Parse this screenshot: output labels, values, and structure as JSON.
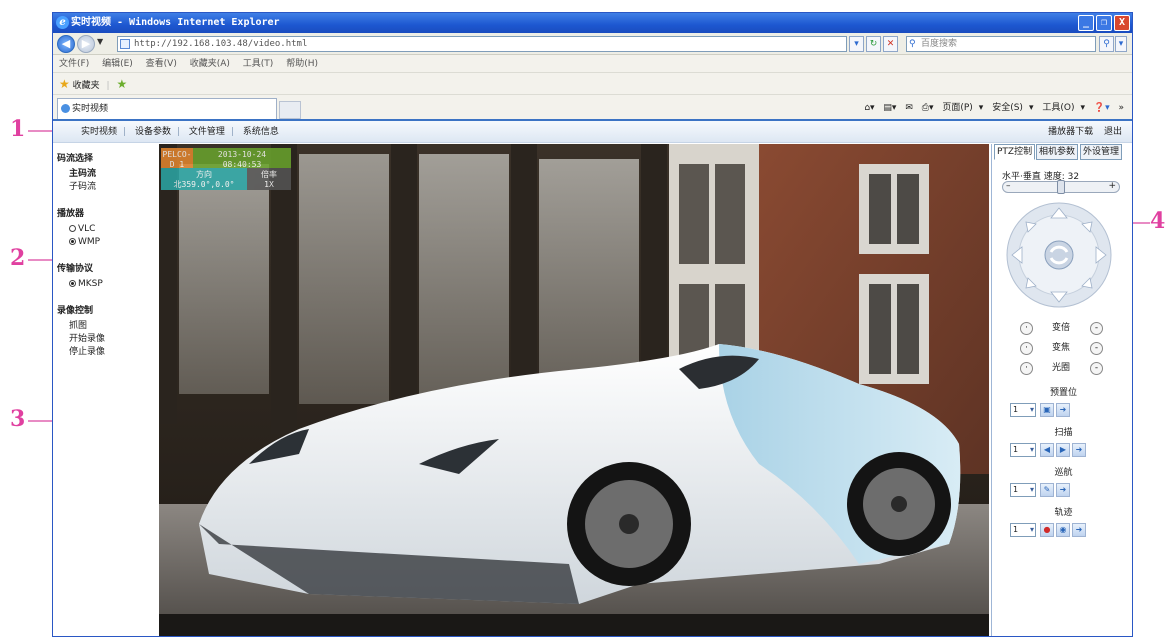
{
  "annotations": [
    "1",
    "2",
    "3",
    "4"
  ],
  "window": {
    "title": "实时视频 - Windows Internet Explorer",
    "minimize_glyph": "_",
    "maximize_glyph": "❐",
    "close_glyph": "X"
  },
  "address": {
    "url": "http://192.168.103.48/video.html",
    "search_placeholder": "百度搜索"
  },
  "menu": [
    "文件(F)",
    "编辑(E)",
    "查看(V)",
    "收藏夹(A)",
    "工具(T)",
    "帮助(H)"
  ],
  "favorites": {
    "label": "收藏夹"
  },
  "tab": {
    "title": "实时视频"
  },
  "command_bar": [
    "页面(P)",
    "安全(S)",
    "工具(O)"
  ],
  "nav": {
    "items": [
      "实时视频",
      "设备参数",
      "文件管理",
      "系统信息"
    ],
    "player_download": "播放器下载",
    "logout": "退出"
  },
  "sidebar": {
    "stream_title": "码流选择",
    "streams": [
      "主码流",
      "子码流"
    ],
    "player_title": "播放器",
    "players": [
      "VLC",
      "WMP"
    ],
    "selected_player": "WMP",
    "protocol_title": "传输协议",
    "protocols": [
      "MKSP"
    ],
    "record_title": "录像控制",
    "record_items": [
      "抓图",
      "开始录像",
      "停止录像"
    ]
  },
  "osd": {
    "channel": "PELCO-D 1",
    "date": "2013-10-24",
    "time": "08:40:53",
    "direction_label": "方向",
    "direction_value": "北359.0°,0.0°",
    "zoom_label": "倍率",
    "zoom_value": "1X"
  },
  "ptz": {
    "tabs": [
      "PTZ控制",
      "相机参数",
      "外设管理"
    ],
    "speed_label": "水平·垂直 速度: 32",
    "speed_value": 32,
    "zoom": "变倍",
    "focus": "变焦",
    "iris": "光圈",
    "preset_title": "预置位",
    "scan_title": "扫描",
    "cruise_title": "巡航",
    "track_title": "轨迹",
    "select_value": "1"
  },
  "colors": {
    "titlebar": "#1d57d0",
    "osd_green": "#6aa52d",
    "osd_orange": "#e5862e",
    "osd_teal": "#2aa7a6",
    "osd_gray": "#555555",
    "annotation": "#e040a0"
  }
}
